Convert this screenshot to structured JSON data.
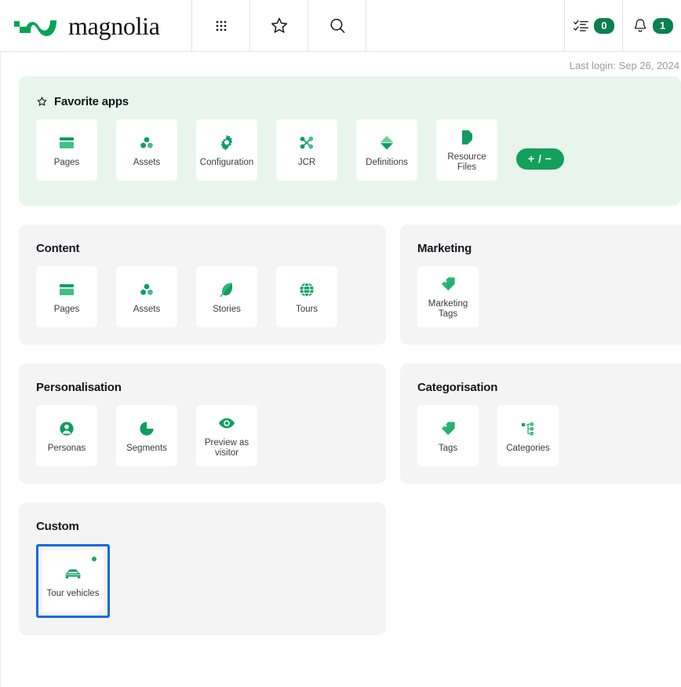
{
  "header": {
    "logo_text": "magnolia",
    "logo_icon": "magnolia-logo-icon",
    "apps_icon": "apps-grid-icon",
    "favorites_icon": "star-icon",
    "search_icon": "search-icon",
    "tasks_icon": "tasks-checklist-icon",
    "tasks_count": "0",
    "notifications_icon": "bell-icon",
    "notifications_count": "1"
  },
  "status": {
    "last_login": "Last login: Sep 26, 2024"
  },
  "colors": {
    "brand_green": "#0a8050",
    "icon_green": "#2cb673",
    "panel_green_bg": "#e7f5ec",
    "panel_grey_bg": "#f4f4f4",
    "focus_blue": "#1268e0",
    "badge_dot_green": "#1aa562"
  },
  "sections": [
    {
      "id": "favorite-apps",
      "title": "Favorite apps",
      "title_icon": "star-icon",
      "edit_button": "+ / −",
      "apps": [
        {
          "label": "Pages",
          "icon": "pages-icon"
        },
        {
          "label": "Assets",
          "icon": "assets-icon"
        },
        {
          "label": "Configuration",
          "icon": "gear-icon"
        },
        {
          "label": "JCR",
          "icon": "jcr-nodes-icon"
        },
        {
          "label": "Definitions",
          "icon": "definitions-diamond-icon"
        },
        {
          "label": "Resource Files",
          "icon": "resource-files-icon"
        }
      ]
    },
    {
      "id": "content",
      "title": "Content",
      "apps": [
        {
          "label": "Pages",
          "icon": "pages-icon"
        },
        {
          "label": "Assets",
          "icon": "assets-icon"
        },
        {
          "label": "Stories",
          "icon": "leaf-icon"
        },
        {
          "label": "Tours",
          "icon": "globe-icon"
        }
      ]
    },
    {
      "id": "marketing",
      "title": "Marketing",
      "apps": [
        {
          "label": "Marketing Tags",
          "icon": "tag-icon"
        }
      ]
    },
    {
      "id": "personalisation",
      "title": "Personalisation",
      "apps": [
        {
          "label": "Personas",
          "icon": "person-circle-icon"
        },
        {
          "label": "Segments",
          "icon": "pie-chart-icon"
        },
        {
          "label": "Preview as visitor",
          "icon": "eye-icon"
        }
      ]
    },
    {
      "id": "categorisation",
      "title": "Categorisation",
      "apps": [
        {
          "label": "Tags",
          "icon": "tag-icon"
        },
        {
          "label": "Categories",
          "icon": "tree-structure-icon"
        }
      ]
    },
    {
      "id": "custom",
      "title": "Custom",
      "apps": [
        {
          "label": "Tour vehicles",
          "icon": "car-icon",
          "focused": true,
          "badge_dot": true
        }
      ]
    }
  ]
}
